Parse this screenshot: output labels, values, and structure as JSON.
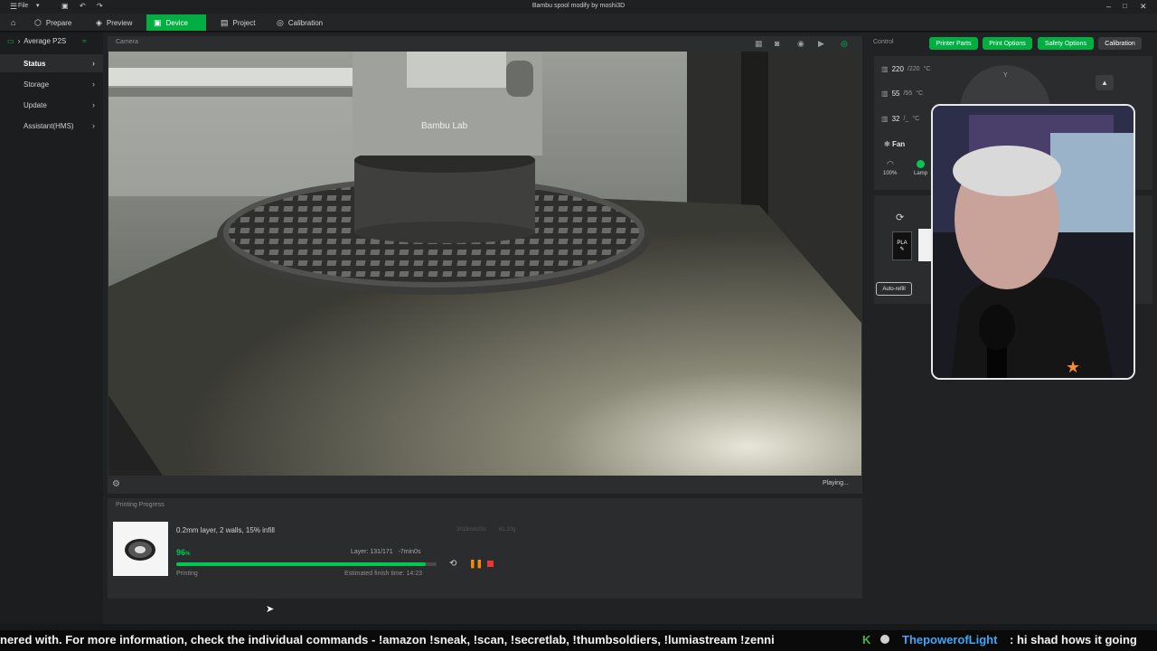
{
  "titlebar": {
    "menu_label": "File",
    "title": "Bambu spool modify by moshi3D"
  },
  "tabs": [
    {
      "label": "Prepare"
    },
    {
      "label": "Preview"
    },
    {
      "label": "Device"
    },
    {
      "label": "Project"
    },
    {
      "label": "Calibration"
    }
  ],
  "sidebar": {
    "printer": "Average P2S",
    "items": [
      {
        "label": "Status"
      },
      {
        "label": "Storage"
      },
      {
        "label": "Update"
      },
      {
        "label": "Assistant(HMS)"
      }
    ]
  },
  "camera": {
    "label": "Camera",
    "state": "Playing...",
    "brand_text": "Bambu Lab"
  },
  "progress": {
    "title": "Printing Progress",
    "job_name": "0.2mm layer, 2 walls, 15% infill",
    "ghost_time": "3h19min29s",
    "ghost_weight": "61.20g",
    "percent_value": "96",
    "percent_suffix": "%",
    "percent": 96,
    "layer_text": "Layer: 131/171",
    "remaining": "-7min0s",
    "status": "Printing",
    "eta": "Estimated finish time: 14:23"
  },
  "control": {
    "label": "Control",
    "buttons": {
      "printer_parts": "Printer Parts",
      "print_options": "Print Options",
      "safety_options": "Safety Options",
      "calibration": "Calibration"
    },
    "temps": [
      {
        "value": "220",
        "target": "/220",
        "unit": "°C"
      },
      {
        "value": "55",
        "target": "/55",
        "unit": "°C"
      },
      {
        "value": "32",
        "target": "/_",
        "unit": "°C"
      }
    ],
    "fan_label": "Fan",
    "fan_percent": "100%",
    "lamp_label": "Lamp",
    "ams_slot_label": "PLA",
    "auto_refill": "Auto-refill",
    "joystick_label": "Y"
  },
  "ticker": {
    "text": "nered with. For more information, check the individual commands - !amazon !sneak, !scan, !secretlab, !thumbsoldiers, !lumiastream !zenni",
    "k": "K",
    "user": "ThepowerofLight",
    "message": ":  hi shad hows it going"
  },
  "colors": {
    "accent": "#00ae42",
    "progress": "#00c853",
    "pause": "#ff8a00",
    "stop": "#e53935"
  }
}
